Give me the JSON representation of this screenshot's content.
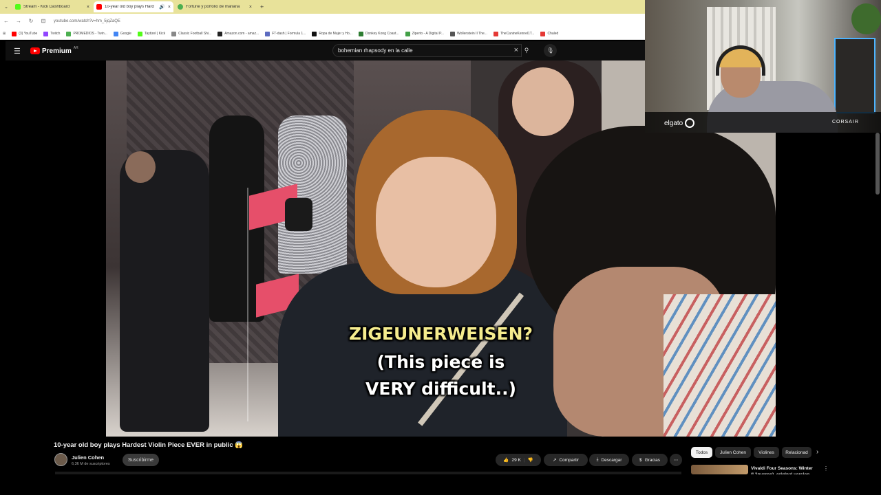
{
  "browser": {
    "tabs": [
      {
        "title": "Stream - Kick Dashboard",
        "active": false,
        "color": "#53fc18"
      },
      {
        "title": "10-year old boy plays Hard",
        "active": true,
        "color": "#ff0000"
      },
      {
        "title": "Fortune y porfolio de mañana",
        "active": false,
        "color": "#4caf50"
      }
    ],
    "url": "youtube.com/watch?v=hm_5jqZaQE",
    "bookmarks": [
      {
        "label": "(3) YouTube",
        "color": "#ff0000"
      },
      {
        "label": "Twitch",
        "color": "#9146ff"
      },
      {
        "label": "PROMEDIOS - Twin...",
        "color": "#4caf50"
      },
      {
        "label": "Google",
        "color": "#4285f4"
      },
      {
        "label": "Taytizel | Kick",
        "color": "#53fc18"
      },
      {
        "label": "Classic Football Shi...",
        "color": "#888888"
      },
      {
        "label": "Amazon.com - amaz...",
        "color": "#222222"
      },
      {
        "label": "FT-dash | Formula 1...",
        "color": "#5c6bc0"
      },
      {
        "label": "Ropa de Mujer y Ho...",
        "color": "#111111"
      },
      {
        "label": "Donkey Kong Coast...",
        "color": "#2e7d32"
      },
      {
        "label": "Ziperto - A Digital P...",
        "color": "#43a047"
      },
      {
        "label": "Wollenstein II The...",
        "color": "#555555"
      },
      {
        "label": "TheCanineKennel1T...",
        "color": "#e53935"
      },
      {
        "label": "Chaled",
        "color": "#e53935"
      }
    ]
  },
  "youtube": {
    "logo_text": "Premium",
    "logo_sup": "AR",
    "search_query": "bohemian rhapsody en la calle",
    "video": {
      "subtitle_line1": "ZIGEUNERWEISEN?",
      "subtitle_line2": "(This piece is",
      "subtitle_line3": "VERY difficult..)"
    },
    "title": "10-year old boy plays Hardest Violin Piece EVER in public 😱",
    "channel": "Julien Cohen",
    "subscribers": "6,36 M de suscriptores",
    "subscribe_label": "Suscribirme",
    "likes": "29 K",
    "share_label": "Compartir",
    "download_label": "Descargar",
    "thanks_label": "Gracias",
    "chips": [
      "Todos",
      "Julien Cohen",
      "Violines",
      "Relacionad"
    ],
    "related_title": "Vivaldi Four Seasons: Winter (L'inverno), original version"
  },
  "webcam": {
    "brand_left": "elgato",
    "brand_right": "CORSAIR"
  },
  "icons": {
    "menu": "hamburger-icon",
    "search": "search-icon",
    "clear": "close-icon",
    "mic": "microphone-icon",
    "like": "thumbs-up-icon",
    "dislike": "thumbs-down-icon",
    "share": "share-icon",
    "download": "download-icon",
    "thanks": "thanks-icon"
  }
}
